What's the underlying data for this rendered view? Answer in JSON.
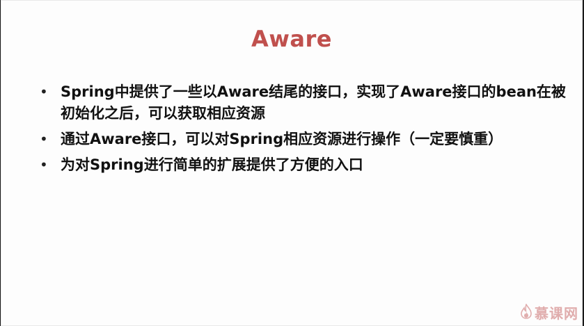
{
  "slide": {
    "title": "Aware",
    "bullets": [
      {
        "marker": "•",
        "text": "Spring中提供了一些以Aware结尾的接口，实现了Aware接口的bean在被初始化之后，可以获取相应资源"
      },
      {
        "marker": "•",
        "text": "通过Aware接口，可以对Spring相应资源进行操作（一定要慎重）"
      },
      {
        "marker": "•",
        "text": "为对Spring进行简单的扩展提供了方便的入口"
      }
    ]
  },
  "watermark": {
    "icon": "flame-icon",
    "text": "慕课网"
  },
  "colors": {
    "title": "#c0504d",
    "text": "#111111",
    "background": "#fdfdfd",
    "watermark": "#dca0a0"
  }
}
